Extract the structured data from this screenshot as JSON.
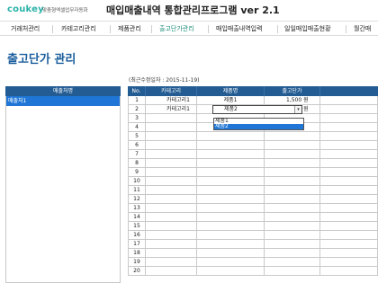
{
  "header": {
    "logo_co": "cou",
    "logo_key": "key",
    "tagline": "맞춤형엑셀업무자동화",
    "title": "매입매출내역 통합관리프로그램 ver 2.1"
  },
  "nav": {
    "items": [
      {
        "label": "거래처관리"
      },
      {
        "label": "카테고리관리"
      },
      {
        "label": "제품관리"
      },
      {
        "label": "출고단가관리"
      },
      {
        "label": "매입매출내역입력"
      },
      {
        "label": "일일매입매출현황"
      },
      {
        "label": "월간매"
      }
    ],
    "active_index": 3
  },
  "page": {
    "title": "출고단가 관리",
    "date_label": "(최근수정일자 : 2015-11-19)"
  },
  "left_table": {
    "header": "매출처명",
    "items": [
      "매출처1"
    ]
  },
  "grid": {
    "headers": [
      "No.",
      "카테고리",
      "제품명",
      "출고단가",
      ""
    ],
    "rows": [
      {
        "no": "1",
        "category": "카테고리1",
        "product": "제품1",
        "price": "1,500 원"
      },
      {
        "no": "2",
        "category": "카테고리1",
        "product": "제품2",
        "price": "2,000 원"
      },
      {
        "no": "3",
        "category": "",
        "product": "",
        "price": ""
      },
      {
        "no": "4",
        "category": "",
        "product": "",
        "price": ""
      },
      {
        "no": "5",
        "category": "",
        "product": "",
        "price": ""
      },
      {
        "no": "6",
        "category": "",
        "product": "",
        "price": ""
      },
      {
        "no": "7",
        "category": "",
        "product": "",
        "price": ""
      },
      {
        "no": "8",
        "category": "",
        "product": "",
        "price": ""
      },
      {
        "no": "9",
        "category": "",
        "product": "",
        "price": ""
      },
      {
        "no": "10",
        "category": "",
        "product": "",
        "price": ""
      },
      {
        "no": "11",
        "category": "",
        "product": "",
        "price": ""
      },
      {
        "no": "12",
        "category": "",
        "product": "",
        "price": ""
      },
      {
        "no": "13",
        "category": "",
        "product": "",
        "price": ""
      },
      {
        "no": "14",
        "category": "",
        "product": "",
        "price": ""
      },
      {
        "no": "15",
        "category": "",
        "product": "",
        "price": ""
      },
      {
        "no": "16",
        "category": "",
        "product": "",
        "price": ""
      },
      {
        "no": "17",
        "category": "",
        "product": "",
        "price": ""
      },
      {
        "no": "18",
        "category": "",
        "product": "",
        "price": ""
      },
      {
        "no": "19",
        "category": "",
        "product": "",
        "price": ""
      },
      {
        "no": "20",
        "category": "",
        "product": "",
        "price": ""
      }
    ]
  },
  "dropdown": {
    "options": [
      "제품1",
      "제품2"
    ],
    "selected_index": 1
  },
  "colors": {
    "header_bg": "#235c93",
    "selection": "#1f76d6",
    "title": "#1a5d9c",
    "logo": "#2bb2a8",
    "active_nav": "#1c8f7a"
  }
}
